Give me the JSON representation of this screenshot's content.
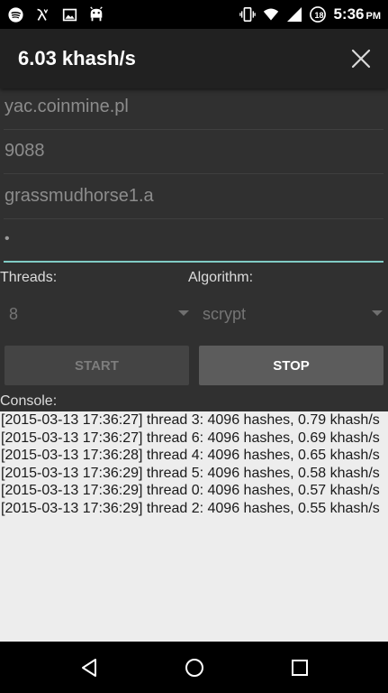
{
  "status_bar": {
    "left_icons": [
      "spotify-icon",
      "lambda-icon",
      "image-icon",
      "android-icon"
    ],
    "right_icons": [
      "vibrate-icon",
      "wifi-icon",
      "signal-icon",
      "battery-icon"
    ],
    "battery_level": "18",
    "time": "5:36",
    "ampm": "PM"
  },
  "app_bar": {
    "title": "6.03 khash/s",
    "close_icon": "close-icon"
  },
  "form": {
    "url": "yac.coinmine.pl",
    "port": "9088",
    "user": "grassmudhorse1.a",
    "password": "•",
    "threads_label": "Threads:",
    "threads_value": "8",
    "algorithm_label": "Algorithm:",
    "algorithm_value": "scrypt"
  },
  "buttons": {
    "start": "START",
    "stop": "STOP"
  },
  "console": {
    "label": "Console:",
    "lines": [
      "[2015-03-13 17:36:27] thread 3: 4096 hashes, 0.79 khash/s",
      "[2015-03-13 17:36:27] thread 6: 4096 hashes, 0.69 khash/s",
      "[2015-03-13 17:36:28] thread 4: 4096 hashes, 0.65 khash/s",
      "[2015-03-13 17:36:29] thread 5: 4096 hashes, 0.58 khash/s",
      "[2015-03-13 17:36:29] thread 0: 4096 hashes, 0.57 khash/s",
      "[2015-03-13 17:36:29] thread 2: 4096 hashes, 0.55 khash/s"
    ]
  },
  "nav_bar": {
    "icons": [
      "back-icon",
      "home-icon",
      "recents-icon"
    ]
  },
  "colors": {
    "accent": "#80cbc4",
    "background": "#303030",
    "app_bar": "#212121",
    "console_bg": "#ededed"
  }
}
